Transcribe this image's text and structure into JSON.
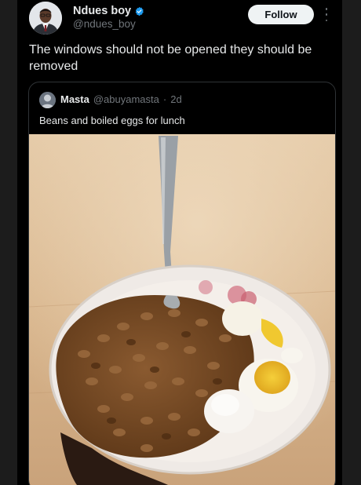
{
  "post": {
    "author_name": "Ndues boy",
    "author_handle": "@ndues_boy",
    "follow_label": "Follow",
    "text": "The windows should not be opened they should be removed"
  },
  "quote": {
    "author_name": "Masta",
    "author_handle": "@abuyamasta",
    "separator": "·",
    "age": "2d",
    "text": "Beans and boiled eggs for lunch"
  },
  "icons": {
    "verified": "verified-badge-icon",
    "more": "more-options-icon"
  },
  "colors": {
    "background": "#000000",
    "text_primary": "#e7e9ea",
    "text_secondary": "#71767b",
    "verified": "#1d9bf0",
    "follow_button": "#eff3f4"
  }
}
